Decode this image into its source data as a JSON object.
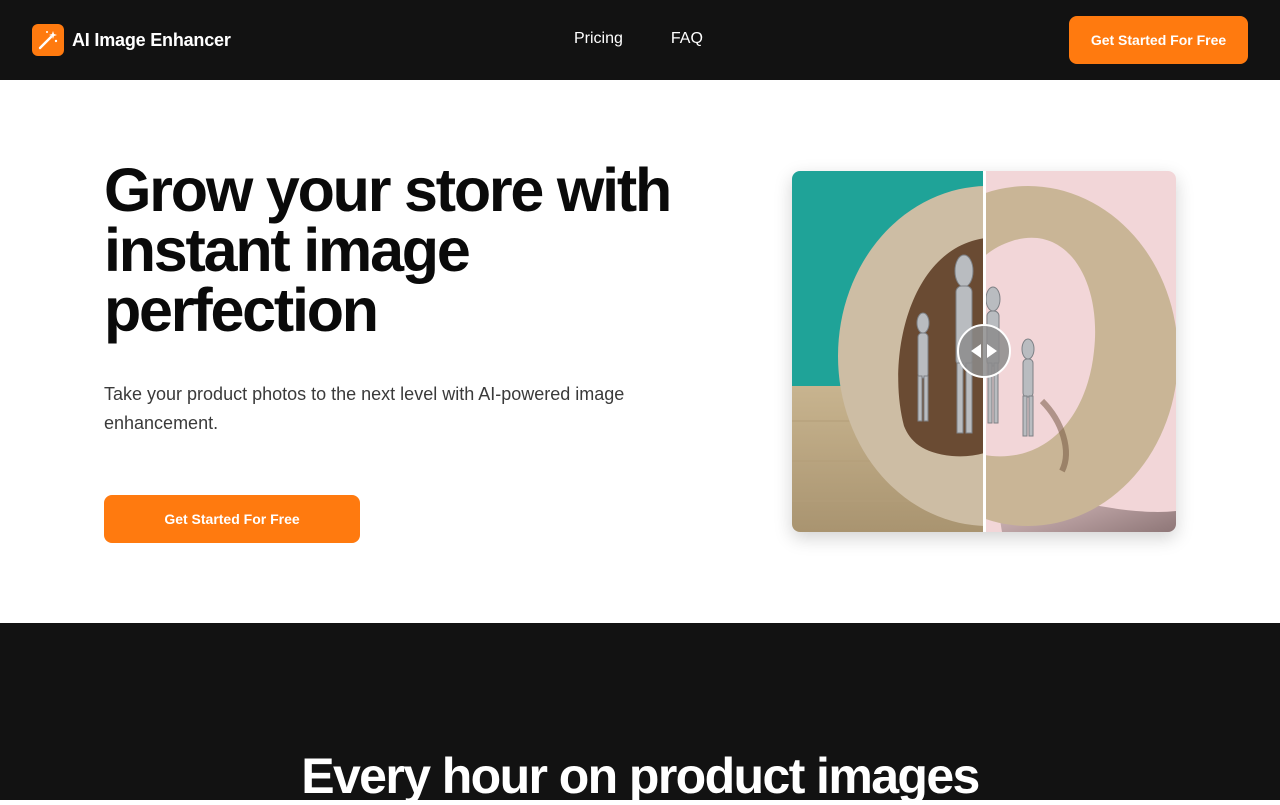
{
  "nav": {
    "brand": "AI Image Enhancer",
    "links": [
      "Pricing",
      "FAQ"
    ],
    "cta": "Get Started For Free"
  },
  "hero": {
    "title": "Grow your store with instant image perfection",
    "subtitle": "Take your product photos to the next level with AI-powered image enhancement.",
    "cta": "Get Started For Free",
    "compare": {
      "before_background": "#1fa398",
      "after_background": "#f2d6d8",
      "divider_position": 0.5
    }
  },
  "section2": {
    "title": "Every hour on product images"
  },
  "colors": {
    "accent": "#ff7a0f",
    "dark": "#121212"
  },
  "icons": {
    "logo": "magic-wand-icon",
    "slider": "left-right-arrows-icon"
  }
}
